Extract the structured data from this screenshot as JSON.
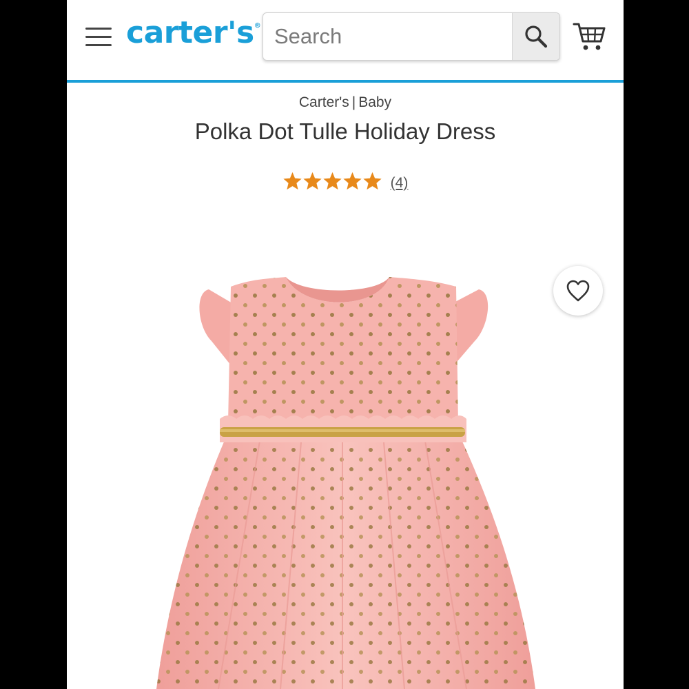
{
  "header": {
    "menu_icon": "hamburger-menu-icon",
    "logo_text": "carter's",
    "search": {
      "placeholder": "Search",
      "value": ""
    },
    "search_icon": "magnifier-icon",
    "cart_icon": "shopping-cart-icon",
    "accent_color": "#1a9fd8"
  },
  "product": {
    "breadcrumb": [
      "Carter's",
      "Baby"
    ],
    "title": "Polka Dot Tulle Holiday Dress",
    "rating": {
      "stars": 5,
      "max": 5,
      "review_count_label": "(4)",
      "star_color": "#e8891a"
    },
    "favorite_icon": "heart-outline-icon",
    "dress_color": "#f7b8b3",
    "trim_color": "#c9a245"
  }
}
